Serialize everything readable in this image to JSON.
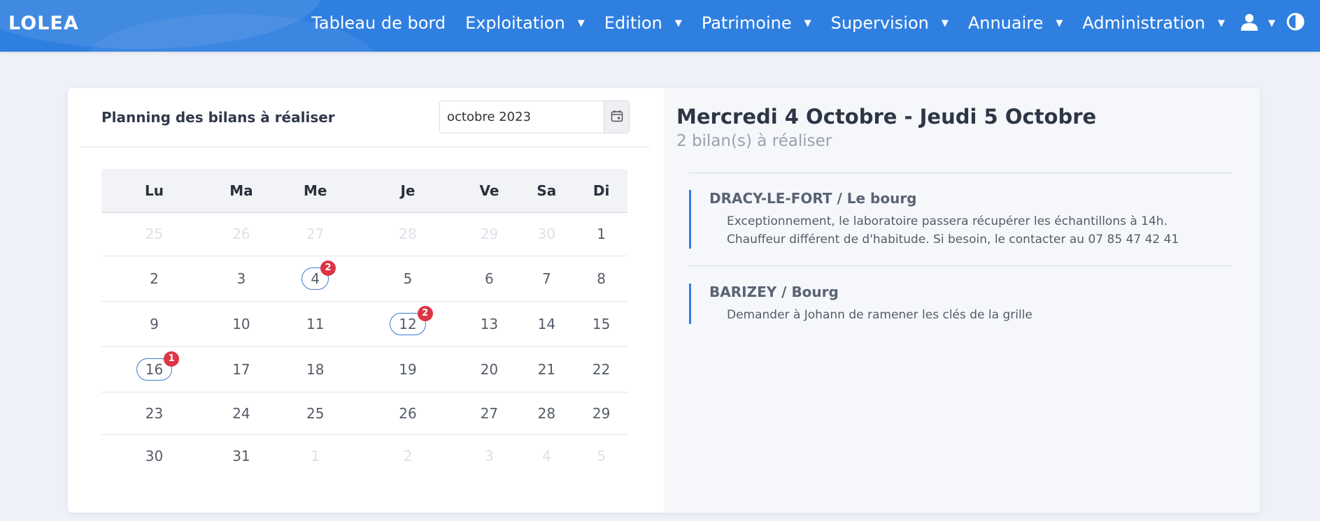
{
  "app": {
    "logo_text": "LOLEA",
    "brand_color": "#2f7fe0"
  },
  "nav": {
    "items": [
      {
        "label": "Tableau de bord"
      },
      {
        "label": "Exploitation"
      },
      {
        "label": "Edition"
      },
      {
        "label": "Patrimoine"
      },
      {
        "label": "Supervision"
      },
      {
        "label": "Annuaire"
      },
      {
        "label": "Administration"
      }
    ],
    "user_icon": "user-icon",
    "theme_icon": "contrast-icon"
  },
  "calendar": {
    "title": "Planning des bilans à réaliser",
    "month_value": "octobre 2023",
    "weekdays": [
      "Lu",
      "Ma",
      "Me",
      "Je",
      "Ve",
      "Sa",
      "Di"
    ],
    "weeks": [
      [
        {
          "d": "25",
          "muted": true
        },
        {
          "d": "26",
          "muted": true
        },
        {
          "d": "27",
          "muted": true
        },
        {
          "d": "28",
          "muted": true
        },
        {
          "d": "29",
          "muted": true
        },
        {
          "d": "30",
          "muted": true
        },
        {
          "d": "1"
        }
      ],
      [
        {
          "d": "2"
        },
        {
          "d": "3"
        },
        {
          "d": "4",
          "marked": true,
          "badge": "2"
        },
        {
          "d": "5"
        },
        {
          "d": "6"
        },
        {
          "d": "7"
        },
        {
          "d": "8"
        }
      ],
      [
        {
          "d": "9"
        },
        {
          "d": "10"
        },
        {
          "d": "11"
        },
        {
          "d": "12",
          "marked": true,
          "badge": "2"
        },
        {
          "d": "13"
        },
        {
          "d": "14"
        },
        {
          "d": "15"
        }
      ],
      [
        {
          "d": "16",
          "marked": true,
          "badge": "1"
        },
        {
          "d": "17"
        },
        {
          "d": "18"
        },
        {
          "d": "19"
        },
        {
          "d": "20"
        },
        {
          "d": "21"
        },
        {
          "d": "22"
        }
      ],
      [
        {
          "d": "23"
        },
        {
          "d": "24"
        },
        {
          "d": "25"
        },
        {
          "d": "26"
        },
        {
          "d": "27"
        },
        {
          "d": "28"
        },
        {
          "d": "29"
        }
      ],
      [
        {
          "d": "30"
        },
        {
          "d": "31"
        },
        {
          "d": "1",
          "muted": true
        },
        {
          "d": "2",
          "muted": true
        },
        {
          "d": "3",
          "muted": true
        },
        {
          "d": "4",
          "muted": true
        },
        {
          "d": "5",
          "muted": true
        }
      ]
    ],
    "badge_color": "#dc3545",
    "marker_color": "#3d78cf"
  },
  "detail": {
    "title": "Mercredi 4 Octobre - Jeudi 5 Octobre",
    "subtitle": "2 bilan(s) à réaliser",
    "entries": [
      {
        "location": "DRACY-LE-FORT / Le bourg",
        "notes": [
          "Exceptionnement, le laboratoire passera récupérer les échantillons à 14h.",
          "Chauffeur différent de d'habitude. Si besoin, le contacter au 07 85 47 42 41"
        ]
      },
      {
        "location": "BARIZEY / Bourg",
        "notes": [
          "Demander à Johann de ramener les clés de la grille"
        ]
      }
    ]
  }
}
